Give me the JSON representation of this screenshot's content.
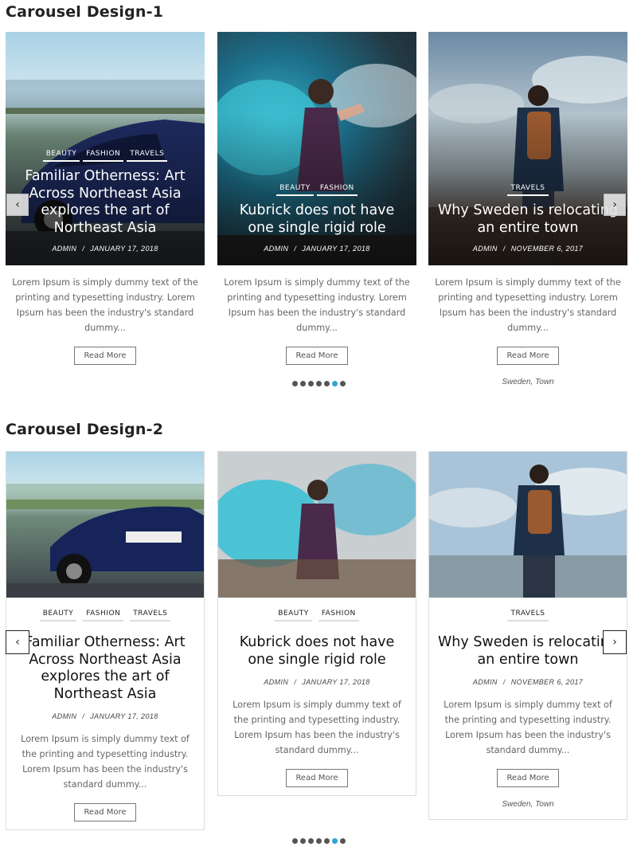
{
  "design1": {
    "title": "Carousel Design-1",
    "read_more": "Read More",
    "cards": [
      {
        "categories": [
          "BEAUTY",
          "FASHION",
          "TRAVELS"
        ],
        "title": "Familiar Otherness: Art Across Northeast Asia explores the art of Northeast Asia",
        "author": "ADMIN",
        "date": "JANUARY 17, 2018",
        "excerpt": "Lorem Ipsum is simply dummy text of the printing and typesetting industry. Lorem Ipsum has been the industry's standard dummy...",
        "tags": ""
      },
      {
        "categories": [
          "BEAUTY",
          "FASHION"
        ],
        "title": "Kubrick does not have one single rigid role",
        "author": "ADMIN",
        "date": "JANUARY 17, 2018",
        "excerpt": "Lorem Ipsum is simply dummy text of the printing and typesetting industry. Lorem Ipsum has been the industry's standard dummy...",
        "tags": ""
      },
      {
        "categories": [
          "TRAVELS"
        ],
        "title": "Why Sweden is relocating an entire town",
        "author": "ADMIN",
        "date": "NOVEMBER 6, 2017",
        "excerpt": "Lorem Ipsum is simply dummy text of the printing and typesetting industry. Lorem Ipsum has been the industry's standard dummy...",
        "tags": "Sweden, Town"
      }
    ],
    "prev_icon": "‹",
    "next_icon": "›"
  },
  "design2": {
    "title": "Carousel Design-2",
    "read_more": "Read More",
    "cards": [
      {
        "categories": [
          "BEAUTY",
          "FASHION",
          "TRAVELS"
        ],
        "title": "Familiar Otherness: Art Across Northeast Asia explores the art of Northeast Asia",
        "author": "ADMIN",
        "date": "JANUARY 17, 2018",
        "excerpt": "Lorem Ipsum is simply dummy text of the printing and typesetting industry. Lorem Ipsum has been the industry's standard dummy...",
        "tags": ""
      },
      {
        "categories": [
          "BEAUTY",
          "FASHION"
        ],
        "title": "Kubrick does not have one single rigid role",
        "author": "ADMIN",
        "date": "JANUARY 17, 2018",
        "excerpt": "Lorem Ipsum is simply dummy text of the printing and typesetting industry. Lorem Ipsum has been the industry's standard dummy...",
        "tags": ""
      },
      {
        "categories": [
          "TRAVELS"
        ],
        "title": "Why Sweden is relocating an entire town",
        "author": "ADMIN",
        "date": "NOVEMBER 6, 2017",
        "excerpt": "Lorem Ipsum is simply dummy text of the printing and typesetting industry. Lorem Ipsum has been the industry's standard dummy...",
        "tags": "Sweden, Town"
      }
    ],
    "prev_icon": "‹",
    "next_icon": "›"
  },
  "pagination": {
    "count": 7,
    "active_index": 5
  },
  "colors": {
    "accent": "#2fa3d6",
    "dot": "#555555"
  }
}
